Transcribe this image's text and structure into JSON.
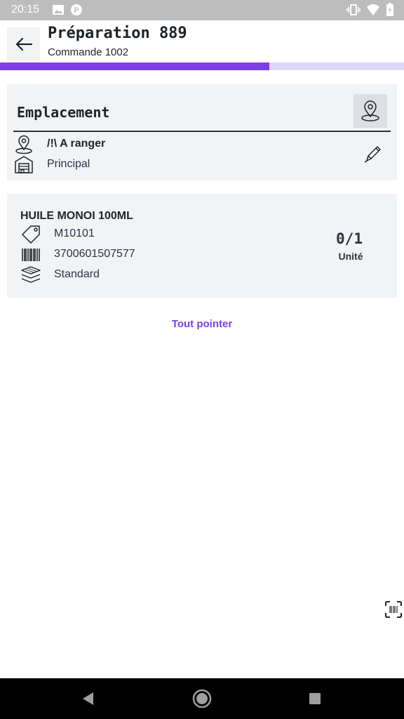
{
  "statusbar": {
    "time": "20:15",
    "left_icons": [
      "image-icon",
      "parking-icon"
    ],
    "right_icons": [
      "vibrate-icon",
      "wifi-icon",
      "battery-icon"
    ]
  },
  "header": {
    "title": "Préparation 889",
    "subtitle": "Commande 1002",
    "back_icon": "arrow-left-icon"
  },
  "progress": {
    "value": 0.667,
    "fill_color": "#7b3fe4",
    "track_color": "#ddd8fb"
  },
  "location": {
    "title": "Emplacement",
    "name": "/!\\ A ranger",
    "zone": "Principal",
    "icons": [
      "map-pin-icon",
      "warehouse-icon",
      "pencil-icon"
    ]
  },
  "product": {
    "name": "HUILE MONOI 100ML",
    "reference": "M10101",
    "barcode": "3700601507577",
    "packaging": "Standard",
    "quantity": "0/1",
    "unit": "Unité",
    "icons": [
      "tag-icon",
      "barcode-icon",
      "layers-icon"
    ]
  },
  "actions": {
    "all_label": "Tout pointer"
  },
  "colors": {
    "accent": "#7b3fe4",
    "card_bg": "#f2f3f5",
    "text": "#1f2328"
  }
}
